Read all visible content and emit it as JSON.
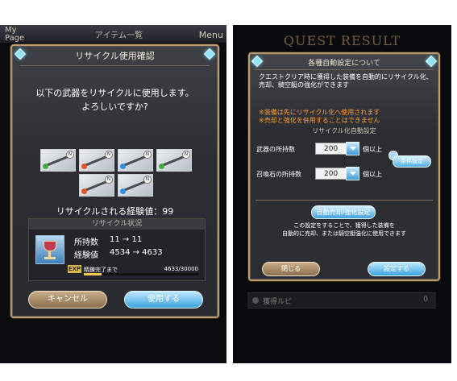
{
  "left": {
    "topbar": {
      "left": "My\nPage",
      "center": "アイテム一覧",
      "right": "Menu"
    },
    "dialog": {
      "title": "リサイクル使用確認",
      "message_line1": "以下の武器をリサイクルに使用します。",
      "message_line2": "よろしいですか?",
      "weapons": [
        {
          "icon": "sword-icon",
          "element": "wind",
          "color": "#3fae3f",
          "badge": "N"
        },
        {
          "icon": "sword-icon",
          "element": "fire",
          "color": "#e2542b",
          "badge": "N"
        },
        {
          "icon": "sword-icon",
          "element": "water",
          "color": "#2f8fe0",
          "badge": "N"
        },
        {
          "icon": "sword-icon",
          "element": "light",
          "color": "#3fae3f",
          "badge": "N"
        },
        {
          "icon": "sword-icon",
          "element": "fire",
          "color": "#e2542b",
          "badge": "N"
        },
        {
          "icon": "sword-icon",
          "element": "water",
          "color": "#2f8fe0",
          "badge": "N"
        }
      ],
      "recycle_exp": "リサイクルされる経験値：99",
      "status_heading": "リサイクル状況",
      "owned_label": "所持数",
      "owned_value": "11 → 11",
      "exp_label": "経験値",
      "exp_value": "4534 → 4633",
      "exp_badge": "EXP",
      "refine_label": "精錬完了まで",
      "refine_value": "4633/30000",
      "refine_fraction": 0.1544,
      "cancel_button": "キャンセル",
      "use_button": "使用する"
    }
  },
  "right": {
    "banner": "QUEST RESULT",
    "dialog": {
      "title": "各種自動設定について",
      "description": "クエストクリア時に獲得した装備を自動的にリサイクル化、売却、騎空艇の強化ができます",
      "warning_line1": "※装備は先にリサイクル化へ使用されます",
      "warning_line2": "※売却と強化を併用することはできません",
      "recycle_heading": "リサイクル化自動設定",
      "weapon_label": "武器の所持数",
      "weapon_value": "200",
      "weapon_unit": "個以上",
      "summon_label": "召喚石の所持数",
      "summon_value": "200",
      "summon_unit": "個以上",
      "condition_button": "条件設定",
      "auto_button": "自動売却/強化設定",
      "note_line1": "この設定をすることで、獲得した装備を",
      "note_line2": "自動的に売却、または騎空艇強化に使用できます",
      "close_button": "閉じる",
      "set_button": "設定する"
    },
    "list": {
      "name": "獲得ルピ",
      "value": "0"
    }
  }
}
